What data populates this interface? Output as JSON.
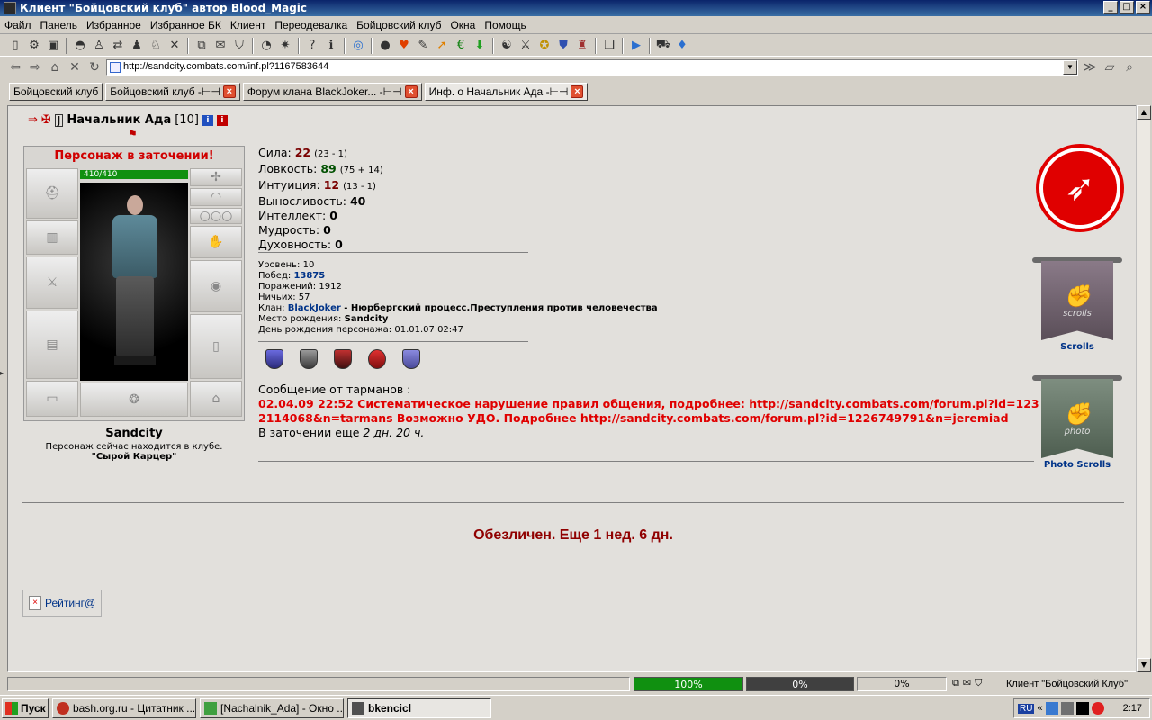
{
  "window": {
    "title": "Клиент \"Бойцовский клуб\" автор Blood_Magic",
    "min": "_",
    "max": "□",
    "close": "×"
  },
  "menu": [
    "Файл",
    "Панель",
    "Избранное",
    "Избранное БК",
    "Клиент",
    "Переодевалка",
    "Бойцовский клуб",
    "Окна",
    "Помощь"
  ],
  "address": {
    "url": "http://sandcity.combats.com/inf.pl?1167583644"
  },
  "tabs": [
    {
      "label": "Бойцовский клуб",
      "closable": false,
      "active": false
    },
    {
      "label": "Бойцовский клуб -⊢⊣",
      "closable": true,
      "active": false
    },
    {
      "label": "Форум клана BlackJoker... -⊢⊣",
      "closable": true,
      "active": false
    },
    {
      "label": "Инф. о Начальник Ада -⊢⊣",
      "closable": true,
      "active": true
    }
  ],
  "character": {
    "name": "Начальник Ада",
    "level_badge": "[10]",
    "jail_banner": "Персонаж в заточении!",
    "hp": "410/410",
    "city": "Sandcity",
    "location_text": "Персонаж сейчас находится в клубе.",
    "room": "\"Сырой Карцер\""
  },
  "stats": [
    {
      "label": "Сила:",
      "value": "22",
      "sub": "(23 - 1)",
      "color": "red"
    },
    {
      "label": "Ловкость:",
      "value": "89",
      "sub": "(75 + 14)",
      "color": "green"
    },
    {
      "label": "Интуиция:",
      "value": "12",
      "sub": "(13 - 1)",
      "color": "red"
    },
    {
      "label": "Выносливость:",
      "value": "40",
      "sub": "",
      "color": ""
    },
    {
      "label": "Интеллект:",
      "value": "0",
      "sub": "",
      "color": ""
    },
    {
      "label": "Мудрость:",
      "value": "0",
      "sub": "",
      "color": ""
    },
    {
      "label": "Духовность:",
      "value": "0",
      "sub": "",
      "color": ""
    }
  ],
  "info": {
    "level": "Уровень: 10",
    "wins_label": "Побед:",
    "wins": "13875",
    "losses": "Поражений: 1912",
    "draws": "Ничьих: 57",
    "clan_label": "Клан:",
    "clan": "BlackJoker",
    "clan_desc": " - Нюрбергский процесс.Преступления против человечества",
    "birthplace_label": "Место рождения:",
    "birthplace": "Sandcity",
    "birthday": "День рождения персонажа: 01.01.07 02:47"
  },
  "message": {
    "header": "Сообщение от тарманов :",
    "body": "02.04.09 22:52 Систематическое нарушение правил общения, подробнее: http://sandcity.combats.com/forum.pl?id=1232114068&n=tarmans Возможно УДО. Подробнее http://sandcity.combats.com/forum.pl?id=1226749791&n=jeremiad",
    "jail_time_prefix": "В заточении еще ",
    "jail_time": "2 дн. 20 ч."
  },
  "anon_text": "Обезличен. Еще 1 нед. 6 дн.",
  "rating_label": "Рейтинг@",
  "side": {
    "scrolls_label": "Scrolls",
    "scrolls_banner_text": "scrolls",
    "photo_label": "Photo Scrolls",
    "photo_banner_text": "photo"
  },
  "status": {
    "p1": "100%",
    "p1_fill": 1.0,
    "p2": "0%",
    "p3": "0%",
    "client": "Клиент \"Бойцовский Клуб\""
  },
  "taskbar": {
    "start": "Пуск",
    "tasks": [
      {
        "label": "bash.org.ru - Цитатник ...",
        "active": false
      },
      {
        "label": "[Nachalnik_Ada] - Окно ...",
        "active": false
      },
      {
        "label": "bkencicl",
        "active": true
      }
    ],
    "lang": "RU",
    "clock": "2:17"
  },
  "colors": {
    "jail_red": "#e00000",
    "link_blue": "#003388",
    "hp_green": "#109010",
    "anon_red": "#900000"
  }
}
